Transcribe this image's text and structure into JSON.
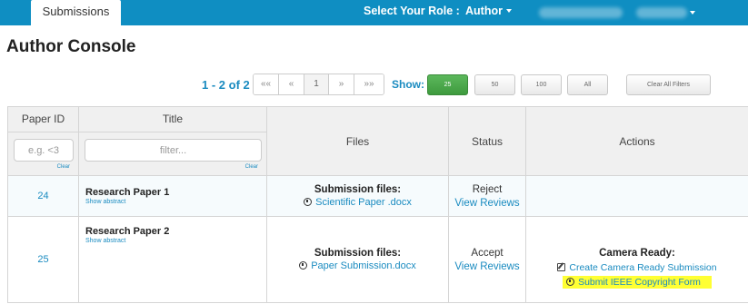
{
  "topbar": {
    "tab_submissions": "Submissions",
    "role_label": "Select Your Role :",
    "role_value": "Author"
  },
  "page": {
    "title": "Author Console"
  },
  "pager": {
    "count": "1 - 2 of 2",
    "buttons": [
      "«",
      "«",
      "1",
      "»",
      "»»"
    ],
    "first_label": "««",
    "prev_label": "«",
    "page_label": "1",
    "next_label": "»",
    "last_label": "»»",
    "show_label": "Show:",
    "size_options": [
      "25",
      "50",
      "100",
      "All"
    ],
    "selected_size": "25",
    "clear_filters": "Clear All Filters"
  },
  "table": {
    "headers": {
      "paper_id": "Paper ID",
      "title": "Title",
      "files": "Files",
      "status": "Status",
      "actions": "Actions"
    },
    "filters": {
      "paper_id_placeholder": "e.g. <3",
      "title_placeholder": "filter...",
      "clear_label": "Clear"
    },
    "rows": [
      {
        "id": "24",
        "title": "Research Paper 1",
        "show_abstract": "Show abstract",
        "files_heading": "Submission files:",
        "file_name": "Scientific Paper .docx",
        "status": "Reject",
        "reviews_link": "View Reviews"
      },
      {
        "id": "25",
        "title": "Research Paper 2",
        "show_abstract": "Show abstract",
        "files_heading": "Submission files:",
        "file_name": "Paper Submission.docx",
        "status": "Accept",
        "reviews_link": "View Reviews",
        "camera_ready_heading": "Camera Ready:",
        "create_camera_ready": "Create Camera Ready Submission",
        "copyright_form": "Submit IEEE Copyright Form"
      }
    ]
  },
  "colors": {
    "topbar": "#0f8ec2",
    "link": "#1a8bc0",
    "active_button": "#5cb85c",
    "highlight": "#ffff33"
  }
}
